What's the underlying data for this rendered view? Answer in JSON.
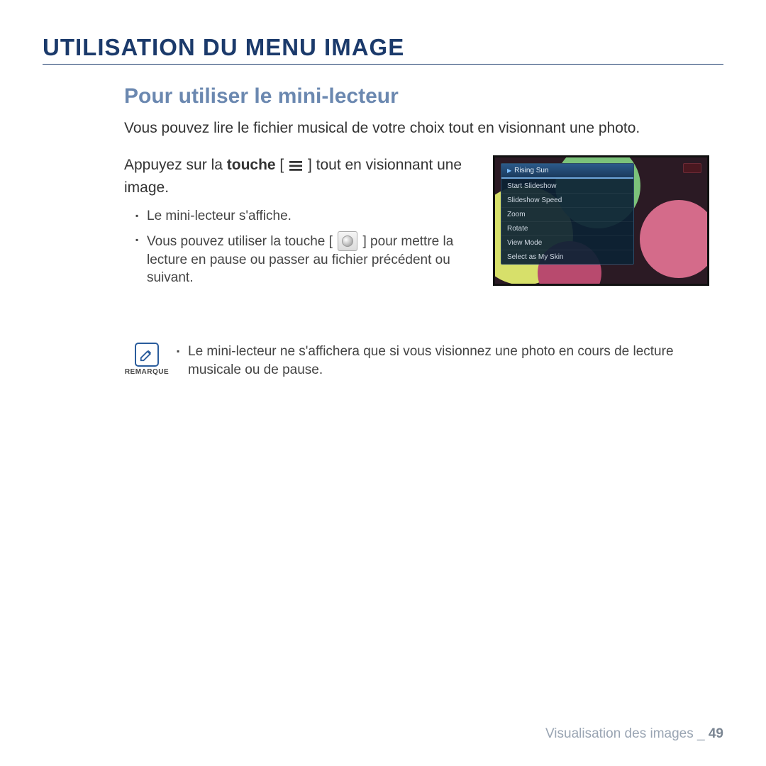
{
  "title": "UTILISATION DU MENU IMAGE",
  "subtitle": "Pour utiliser le mini-lecteur",
  "intro": "Vous pouvez lire le fichier musical de votre choix tout en visionnant une photo.",
  "step": {
    "prefix": "Appuyez sur la ",
    "bold": "touche",
    "open_bracket": " [ ",
    "close_bracket": " ] ",
    "suffix": "tout en visionnant une image."
  },
  "bullets": [
    "Le mini-lecteur s'affiche.",
    {
      "pre": "Vous pouvez utiliser la touche [ ",
      "post": " ] pour mettre la lecture en pause ou passer au fichier précédent ou suivant."
    }
  ],
  "note": {
    "label": "REMARQUE",
    "text": "Le mini-lecteur ne s'affichera que si vous visionnez une photo en cours de lecture musicale ou de pause."
  },
  "screen_menu": {
    "header": "Rising Sun",
    "items": [
      "Start Slideshow",
      "Slideshow Speed",
      "Zoom",
      "Rotate",
      "View Mode",
      "Select as My Skin"
    ]
  },
  "footer": {
    "section": "Visualisation des images",
    "sep": " _ ",
    "page": "49"
  }
}
